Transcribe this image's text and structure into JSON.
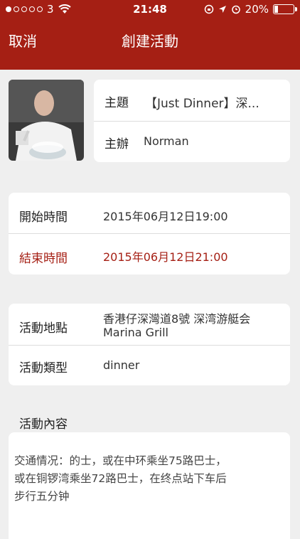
{
  "status_bar": {
    "carrier": "3",
    "time": "21:48",
    "battery": "20%",
    "battery_level": 0.2
  },
  "nav": {
    "cancel_label": "取消",
    "title": "創建活動"
  },
  "event": {
    "subject_label": "主題",
    "subject_value": "【Just Dinner】深...",
    "host_label": "主辦",
    "host_value": "Norman"
  },
  "time": {
    "start_label": "開始時間",
    "start_value": "2015年06月12日19:00",
    "end_label": "結束時間",
    "end_value": "2015年06月12日21:00"
  },
  "place": {
    "location_label": "活動地點",
    "location_line1": "香港仔深灣道8號 深湾游艇会",
    "location_line2": "Marina Grill",
    "type_label": "活動類型",
    "type_value": "dinner"
  },
  "content": {
    "section_label": "活動內容",
    "text_line1": "交通情况：的士，或在中环乘坐75路巴士，",
    "text_line2": "或在铜锣湾乘坐72路巴士，在终点站下车后",
    "text_line3": "步行五分钟"
  }
}
